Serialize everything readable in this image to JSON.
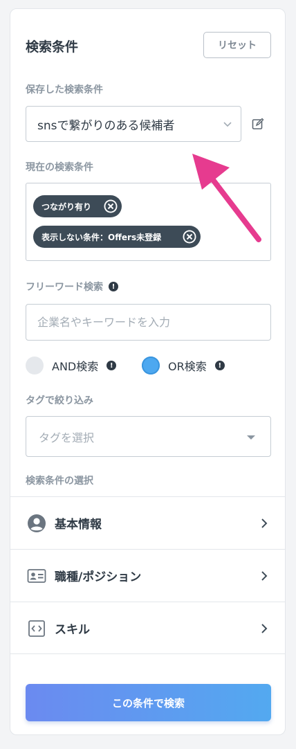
{
  "header": {
    "title": "検索条件",
    "reset_label": "リセット"
  },
  "saved": {
    "label": "保存した検索条件",
    "selected": "snsで繋がりのある候補者"
  },
  "current": {
    "label": "現在の検索条件",
    "chips": [
      "つながり有り",
      "表示しない条件：Offers未登録"
    ]
  },
  "freeword": {
    "label": "フリーワード検索",
    "placeholder": "企業名やキーワードを入力",
    "value": ""
  },
  "mode": {
    "and_label": "AND検索",
    "or_label": "OR検索",
    "selected": "OR"
  },
  "tags": {
    "label": "タグで絞り込み",
    "placeholder": "タグを選択"
  },
  "sections": {
    "label": "検索条件の選択",
    "items": [
      {
        "label": "基本情報",
        "icon": "user-circle-icon"
      },
      {
        "label": "職種/ポジション",
        "icon": "id-card-icon"
      },
      {
        "label": "スキル",
        "icon": "code-icon"
      }
    ]
  },
  "submit_label": "この条件で検索",
  "colors": {
    "accent": "#e63b8f",
    "chip_bg": "#3d4b57",
    "radio_on": "#4da8f0",
    "radio_off": "#e5e8ec"
  }
}
